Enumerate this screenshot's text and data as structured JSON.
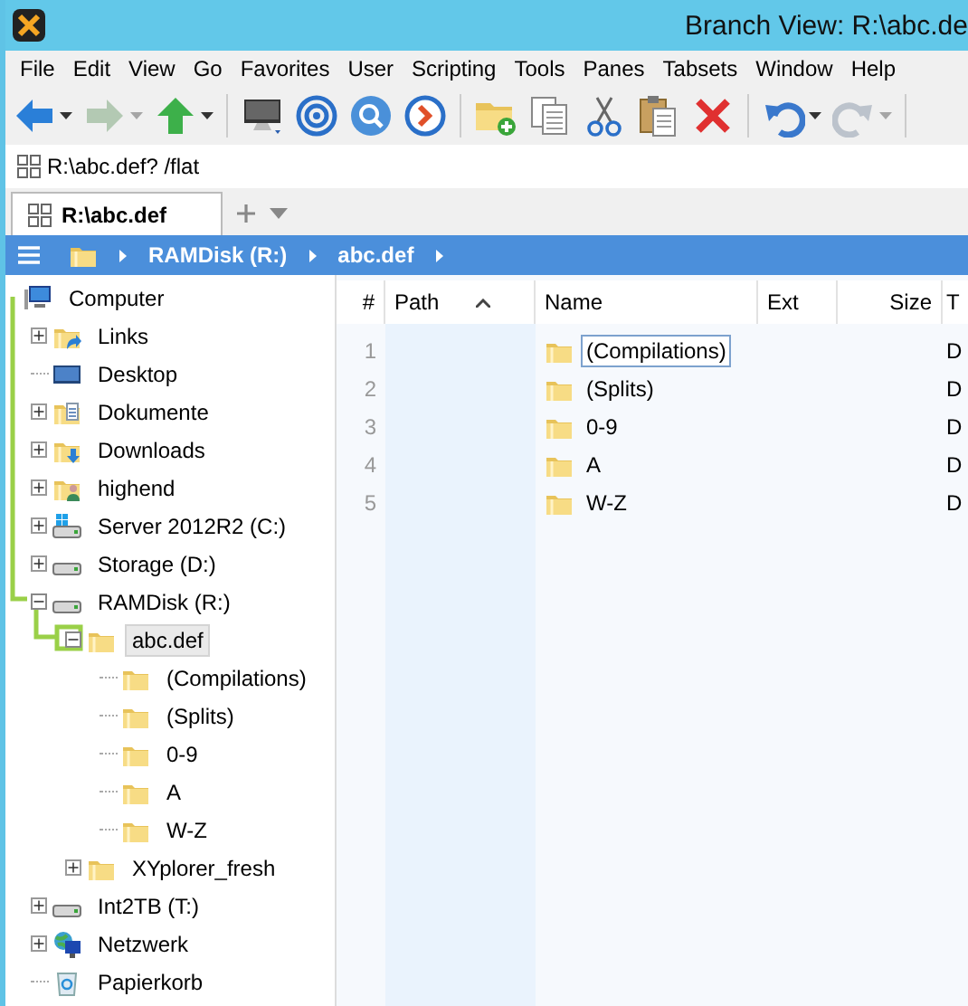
{
  "window": {
    "title": "Branch View: R:\\abc.de"
  },
  "menu": [
    {
      "label": "File"
    },
    {
      "label": "Edit"
    },
    {
      "label": "View"
    },
    {
      "label": "Go"
    },
    {
      "label": "Favorites"
    },
    {
      "label": "User"
    },
    {
      "label": "Scripting"
    },
    {
      "label": "Tools"
    },
    {
      "label": "Panes"
    },
    {
      "label": "Tabsets"
    },
    {
      "label": "Window"
    },
    {
      "label": "Help"
    }
  ],
  "toolbar": [
    {
      "kind": "back",
      "dropdown": true,
      "disabled": false
    },
    {
      "kind": "forward",
      "dropdown": true,
      "disabled": true
    },
    {
      "kind": "up",
      "dropdown": true,
      "disabled": false
    },
    {
      "kind": "separator"
    },
    {
      "kind": "computer",
      "dropdown": false,
      "disabled": false
    },
    {
      "kind": "target",
      "dropdown": false,
      "disabled": false
    },
    {
      "kind": "search",
      "dropdown": false,
      "disabled": false
    },
    {
      "kind": "goto",
      "dropdown": false,
      "disabled": false
    },
    {
      "kind": "separator"
    },
    {
      "kind": "new-folder",
      "dropdown": false,
      "disabled": false
    },
    {
      "kind": "copy",
      "dropdown": false,
      "disabled": false
    },
    {
      "kind": "cut",
      "dropdown": false,
      "disabled": false
    },
    {
      "kind": "paste",
      "dropdown": false,
      "disabled": false
    },
    {
      "kind": "delete",
      "dropdown": false,
      "disabled": false
    },
    {
      "kind": "separator"
    },
    {
      "kind": "undo",
      "dropdown": true,
      "disabled": false
    },
    {
      "kind": "redo",
      "dropdown": true,
      "disabled": true
    },
    {
      "kind": "separator"
    }
  ],
  "address_bar": {
    "value": "R:\\abc.def? /flat"
  },
  "tabs": [
    {
      "label": "R:\\abc.def",
      "selected": true
    }
  ],
  "breadcrumb": [
    {
      "label": "RAMDisk (R:)"
    },
    {
      "label": "abc.def"
    }
  ],
  "tree": [
    {
      "label": "Computer",
      "kind": "computer",
      "expanded": true,
      "selected": false,
      "children": [
        {
          "label": "Links",
          "kind": "folder-link",
          "expandable": true,
          "expanded": false,
          "selected": false
        },
        {
          "label": "Desktop",
          "kind": "desktop",
          "expandable": false,
          "selected": false
        },
        {
          "label": "Dokumente",
          "kind": "folder-doc",
          "expandable": true,
          "expanded": false,
          "selected": false
        },
        {
          "label": "Downloads",
          "kind": "folder-download",
          "expandable": true,
          "expanded": false,
          "selected": false
        },
        {
          "label": "highend",
          "kind": "folder-user",
          "expandable": true,
          "expanded": false,
          "selected": false
        },
        {
          "label": "Server 2012R2 (C:)",
          "kind": "drive-system",
          "expandable": true,
          "expanded": false,
          "selected": false
        },
        {
          "label": "Storage (D:)",
          "kind": "drive",
          "expandable": true,
          "expanded": false,
          "selected": false
        },
        {
          "label": "RAMDisk (R:)",
          "kind": "drive",
          "expandable": true,
          "expanded": true,
          "selected": false,
          "children": [
            {
              "label": "abc.def",
              "kind": "folder",
              "expandable": true,
              "expanded": true,
              "selected": true,
              "children": [
                {
                  "label": "(Compilations)",
                  "kind": "folder",
                  "expandable": false,
                  "selected": false
                },
                {
                  "label": "(Splits)",
                  "kind": "folder",
                  "expandable": false,
                  "selected": false
                },
                {
                  "label": "0-9",
                  "kind": "folder",
                  "expandable": false,
                  "selected": false
                },
                {
                  "label": "A",
                  "kind": "folder",
                  "expandable": false,
                  "selected": false
                },
                {
                  "label": "W-Z",
                  "kind": "folder",
                  "expandable": false,
                  "selected": false
                }
              ]
            },
            {
              "label": "XYplorer_fresh",
              "kind": "folder",
              "expandable": true,
              "expanded": false,
              "selected": false
            }
          ]
        },
        {
          "label": "Int2TB (T:)",
          "kind": "drive",
          "expandable": true,
          "expanded": false,
          "selected": false
        },
        {
          "label": "Netzwerk",
          "kind": "network",
          "expandable": true,
          "expanded": false,
          "selected": false
        },
        {
          "label": "Papierkorb",
          "kind": "recycle-bin",
          "expandable": false,
          "selected": false
        }
      ]
    }
  ],
  "file_list": {
    "columns": [
      {
        "label": "#",
        "sorted": false
      },
      {
        "label": "Path",
        "sorted": true
      },
      {
        "label": "Name",
        "sorted": false
      },
      {
        "label": "Ext",
        "sorted": false
      },
      {
        "label": "Size",
        "sorted": false
      },
      {
        "label": "T",
        "sorted": false
      }
    ],
    "rows": [
      {
        "number": "1",
        "name": "(Compilations)",
        "column_6": "D",
        "focused": true
      },
      {
        "number": "2",
        "name": "(Splits)",
        "column_6": "D",
        "focused": false
      },
      {
        "number": "3",
        "name": "0-9",
        "column_6": "D",
        "focused": false
      },
      {
        "number": "4",
        "name": "A",
        "column_6": "D",
        "focused": false
      },
      {
        "number": "5",
        "name": "W-Z",
        "column_6": "D",
        "focused": false
      }
    ]
  }
}
